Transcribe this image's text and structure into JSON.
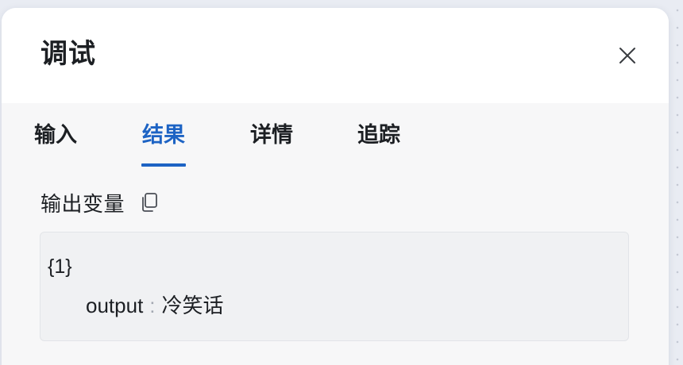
{
  "panel": {
    "title": "调试",
    "close_icon": "close-icon"
  },
  "tabs": [
    {
      "label": "输入",
      "active": false
    },
    {
      "label": "结果",
      "active": true
    },
    {
      "label": "详情",
      "active": false
    },
    {
      "label": "追踪",
      "active": false
    }
  ],
  "result": {
    "section_label": "输出变量",
    "copy_icon": "copy-icon",
    "object_summary": "{1}",
    "variables": [
      {
        "key": "output",
        "separator": ":",
        "value": "冷笑话"
      }
    ]
  },
  "colors": {
    "accent": "#1d63c4",
    "text": "#1c1f23",
    "panel_body": "#f7f7f8",
    "output_box": "#f0f1f3"
  }
}
